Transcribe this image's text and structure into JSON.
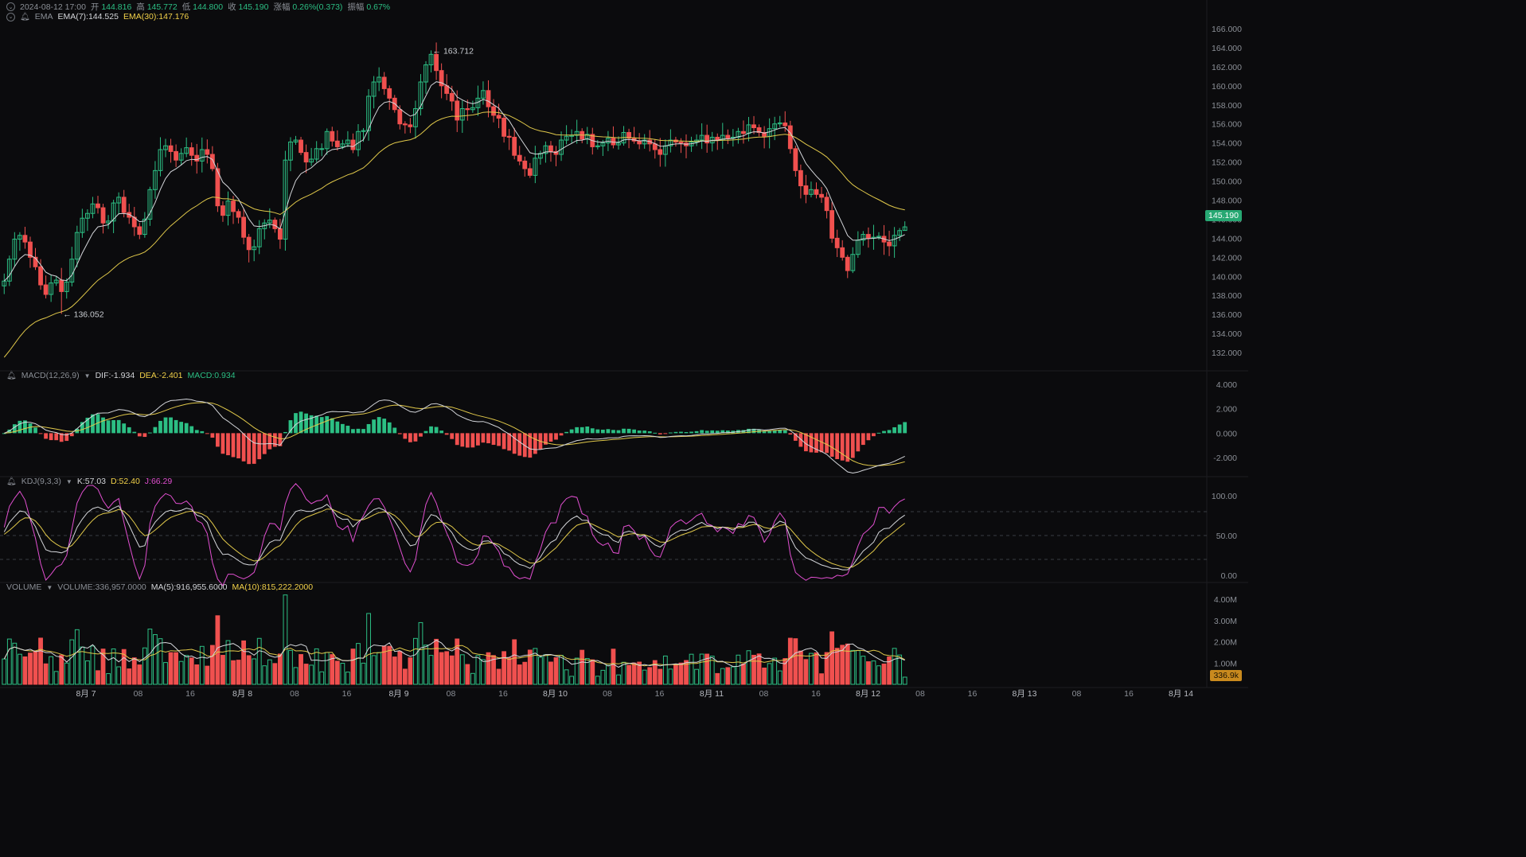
{
  "header": {
    "datetime": "2024-08-12 17:00",
    "open_label": "开",
    "open": "144.816",
    "high_label": "高",
    "high": "145.772",
    "low_label": "低",
    "low": "144.800",
    "close_label": "收",
    "close": "145.190",
    "change_label": "涨幅",
    "change": "0.26%(0.373)",
    "amp_label": "振幅",
    "amp": "0.67%"
  },
  "ema": {
    "name": "EMA",
    "ema7": "EMA(7):144.525",
    "ema30": "EMA(30):147.176"
  },
  "macd": {
    "name": "MACD(12,26,9)",
    "dif": "DIF:-1.934",
    "dea": "DEA:-2.401",
    "macd": "MACD:0.934"
  },
  "kdj": {
    "name": "KDJ(9,3,3)",
    "k": "K:57.03",
    "d": "D:52.40",
    "j": "J:66.29"
  },
  "volume": {
    "name": "VOLUME",
    "vol": "VOLUME:336,957.0000",
    "ma5": "MA(5):916,955.6000",
    "ma10": "MA(10):815,222.2000"
  },
  "price_axis": [
    "166.000",
    "164.000",
    "162.000",
    "160.000",
    "158.000",
    "156.000",
    "154.000",
    "152.000",
    "150.000",
    "148.000",
    "146.000",
    "144.000",
    "142.000",
    "140.000",
    "138.000",
    "136.000",
    "134.000",
    "132.000"
  ],
  "macd_axis": [
    "4.000",
    "2.000",
    "0.000",
    "-2.000"
  ],
  "kdj_axis": [
    "100.00",
    "50.00",
    "0.00"
  ],
  "vol_axis": [
    "4.00M",
    "3.00M",
    "2.00M",
    "1.00M"
  ],
  "time_axis": [
    "8月 7",
    "08",
    "16",
    "8月 8",
    "08",
    "16",
    "8月 9",
    "08",
    "16",
    "8月 10",
    "08",
    "16",
    "8月 11",
    "08",
    "16",
    "8月 12",
    "08",
    "16",
    "8月 13",
    "08",
    "16",
    "8月 14"
  ],
  "last_price": "145.190",
  "last_volume": "336.9k",
  "high_marker": "163.712",
  "low_marker": "136.052",
  "colors": {
    "up": "#2cbf84",
    "down": "#f0504f",
    "ema7": "#d4d6da",
    "ema30": "#e0c84a",
    "j": "#e14fd0",
    "bg": "#0b0b0d"
  },
  "chart_data": {
    "type": "candlestick",
    "bar_interval": "1h",
    "closes": [
      139.5,
      141.8,
      143.9,
      144.3,
      143.6,
      142.0,
      141.0,
      139.1,
      138.1,
      139.3,
      139.6,
      138.4,
      139.4,
      141.8,
      144.6,
      146.1,
      146.6,
      147.6,
      147.2,
      145.6,
      145.8,
      147.7,
      148.3,
      146.7,
      146.2,
      145.2,
      144.4,
      146.0,
      149.1,
      151.1,
      153.3,
      153.7,
      153.1,
      152.2,
      152.9,
      153.5,
      152.7,
      152.1,
      153.3,
      152.8,
      151.3,
      147.4,
      146.4,
      147.9,
      146.8,
      146.2,
      144.1,
      142.8,
      143.1,
      145.0,
      145.6,
      145.9,
      145.0,
      143.9,
      152.2,
      154.1,
      154.3,
      153.0,
      152.0,
      152.3,
      153.4,
      153.4,
      155.2,
      154.2,
      153.6,
      153.9,
      154.3,
      153.3,
      155.2,
      155.3,
      158.9,
      160.4,
      160.9,
      159.7,
      158.7,
      157.5,
      156.0,
      155.9,
      155.7,
      157.6,
      160.4,
      162.2,
      163.3,
      161.6,
      160.0,
      159.2,
      158.4,
      156.4,
      157.6,
      157.5,
      157.7,
      158.7,
      159.5,
      157.8,
      156.9,
      156.6,
      154.7,
      154.6,
      152.7,
      152.1,
      151.3,
      150.6,
      152.4,
      152.9,
      153.7,
      153.1,
      152.8,
      154.3,
      154.7,
      154.8,
      155.2,
      154.4,
      154.9,
      153.6,
      153.7,
      154.0,
      154.5,
      153.8,
      154.0,
      155.1,
      154.5,
      154.2,
      153.9,
      154.3,
      153.9,
      153.3,
      152.8,
      153.7,
      154.3,
      154.1,
      154.0,
      153.7,
      154.1,
      154.3,
      154.8,
      154.0,
      154.6,
      154.3,
      154.8,
      154.5,
      154.6,
      155.2,
      155.0,
      155.9,
      155.6,
      155.1,
      154.7,
      155.5,
      156.0,
      156.1,
      155.8,
      153.4,
      151.1,
      149.5,
      148.6,
      149.1,
      148.6,
      148.3,
      146.9,
      144.0,
      143.0,
      142.0,
      140.6,
      142.3,
      143.8,
      144.4,
      144.0,
      144.1,
      144.2,
      143.6,
      143.2,
      144.3,
      144.8,
      145.19
    ],
    "price_range": [
      131.0,
      166.5
    ],
    "high_marker": 163.712,
    "low_marker": 136.052,
    "ema7_last": 144.525,
    "ema30_last": 147.176,
    "macd": {
      "dif": -1.934,
      "dea": -2.401,
      "macd": 0.934,
      "range": [
        -3.5,
        4.2
      ]
    },
    "kdj": {
      "k": 57.03,
      "d": 52.4,
      "j": 66.29,
      "range": [
        -5,
        110
      ]
    },
    "volume": {
      "last": 336957,
      "ma5": 916955.6,
      "ma10": 815222.2,
      "max": 4300000
    },
    "x_ticks": [
      "8月 7",
      "08",
      "16",
      "8月 8",
      "08",
      "16",
      "8月 9",
      "08",
      "16",
      "8月 10",
      "08",
      "16",
      "8月 11",
      "08",
      "16",
      "8月 12",
      "08",
      "16",
      "8月 13",
      "08",
      "16",
      "8月 14"
    ]
  }
}
